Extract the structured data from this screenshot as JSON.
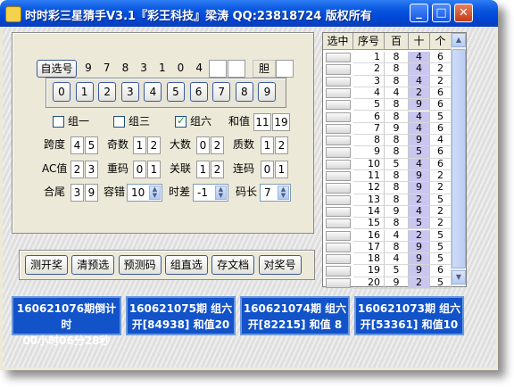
{
  "window": {
    "title": "时时彩三星猜手V3.1『彩王科技』梁涛 QQ:23818724 版权所有"
  },
  "selection": {
    "button": "自选号",
    "digits": [
      "9",
      "7",
      "8",
      "3",
      "1",
      "0",
      "4"
    ],
    "dan_label": "胆"
  },
  "digit_buttons": [
    "0",
    "1",
    "2",
    "3",
    "4",
    "5",
    "6",
    "7",
    "8",
    "9"
  ],
  "checks": {
    "zu1": {
      "label": "组一",
      "checked": false
    },
    "zu3": {
      "label": "组三",
      "checked": false
    },
    "zu6": {
      "label": "组六",
      "checked": true
    }
  },
  "sum": {
    "label": "和值",
    "min": "11",
    "max": "19"
  },
  "params": {
    "kuadu": {
      "label": "跨度",
      "a": "4",
      "b": "5"
    },
    "jishu": {
      "label": "奇数",
      "a": "1",
      "b": "2"
    },
    "dashu": {
      "label": "大数",
      "a": "0",
      "b": "2"
    },
    "zhishu": {
      "label": "质数",
      "a": "1",
      "b": "2"
    },
    "ac": {
      "label": "AC值",
      "a": "2",
      "b": "3"
    },
    "chonghao": {
      "label": "重码",
      "a": "0",
      "b": "1"
    },
    "guanlian": {
      "label": "关联",
      "a": "1",
      "b": "2"
    },
    "lianhao": {
      "label": "连码",
      "a": "0",
      "b": "1"
    },
    "hewei": {
      "label": "合尾",
      "a": "3",
      "b": "9"
    }
  },
  "spinners": {
    "rongcuo": {
      "label": "容错",
      "value": "10"
    },
    "shicha": {
      "label": "时差",
      "value": "-1"
    },
    "machang": {
      "label": "码长",
      "value": "7"
    }
  },
  "actions": [
    "测开奖",
    "清预选",
    "预测码",
    "组直选",
    "存文档",
    "对奖号"
  ],
  "table": {
    "headers": [
      "选中",
      "序号",
      "百",
      "十",
      "个"
    ],
    "rows": [
      [
        "1",
        "8",
        "4",
        "6"
      ],
      [
        "2",
        "8",
        "4",
        "2"
      ],
      [
        "3",
        "8",
        "4",
        "2"
      ],
      [
        "4",
        "4",
        "2",
        "6"
      ],
      [
        "5",
        "8",
        "9",
        "6"
      ],
      [
        "6",
        "8",
        "4",
        "5"
      ],
      [
        "7",
        "9",
        "4",
        "6"
      ],
      [
        "8",
        "8",
        "9",
        "4"
      ],
      [
        "9",
        "8",
        "5",
        "6"
      ],
      [
        "10",
        "5",
        "4",
        "6"
      ],
      [
        "11",
        "8",
        "9",
        "2"
      ],
      [
        "12",
        "8",
        "9",
        "2"
      ],
      [
        "13",
        "8",
        "2",
        "5"
      ],
      [
        "14",
        "9",
        "4",
        "2"
      ],
      [
        "15",
        "8",
        "5",
        "2"
      ],
      [
        "16",
        "4",
        "2",
        "5"
      ],
      [
        "17",
        "8",
        "9",
        "5"
      ],
      [
        "18",
        "4",
        "9",
        "5"
      ],
      [
        "19",
        "5",
        "9",
        "6"
      ],
      [
        "20",
        "9",
        "2",
        "5"
      ]
    ]
  },
  "info": [
    {
      "line1": "160621076期倒计时",
      "line2": "00小时06分28秒"
    },
    {
      "line1": "160621075期 组六",
      "line2": "开[84938] 和值20"
    },
    {
      "line1": "160621074期 组六",
      "line2": "开[82215] 和值 8"
    },
    {
      "line1": "160621073期 组六",
      "line2": "开[53361] 和值10"
    }
  ],
  "colors": {
    "title_bar": "#0046d5",
    "info_panel": "#1253c9",
    "table_highlight": "#c9c6f0"
  }
}
